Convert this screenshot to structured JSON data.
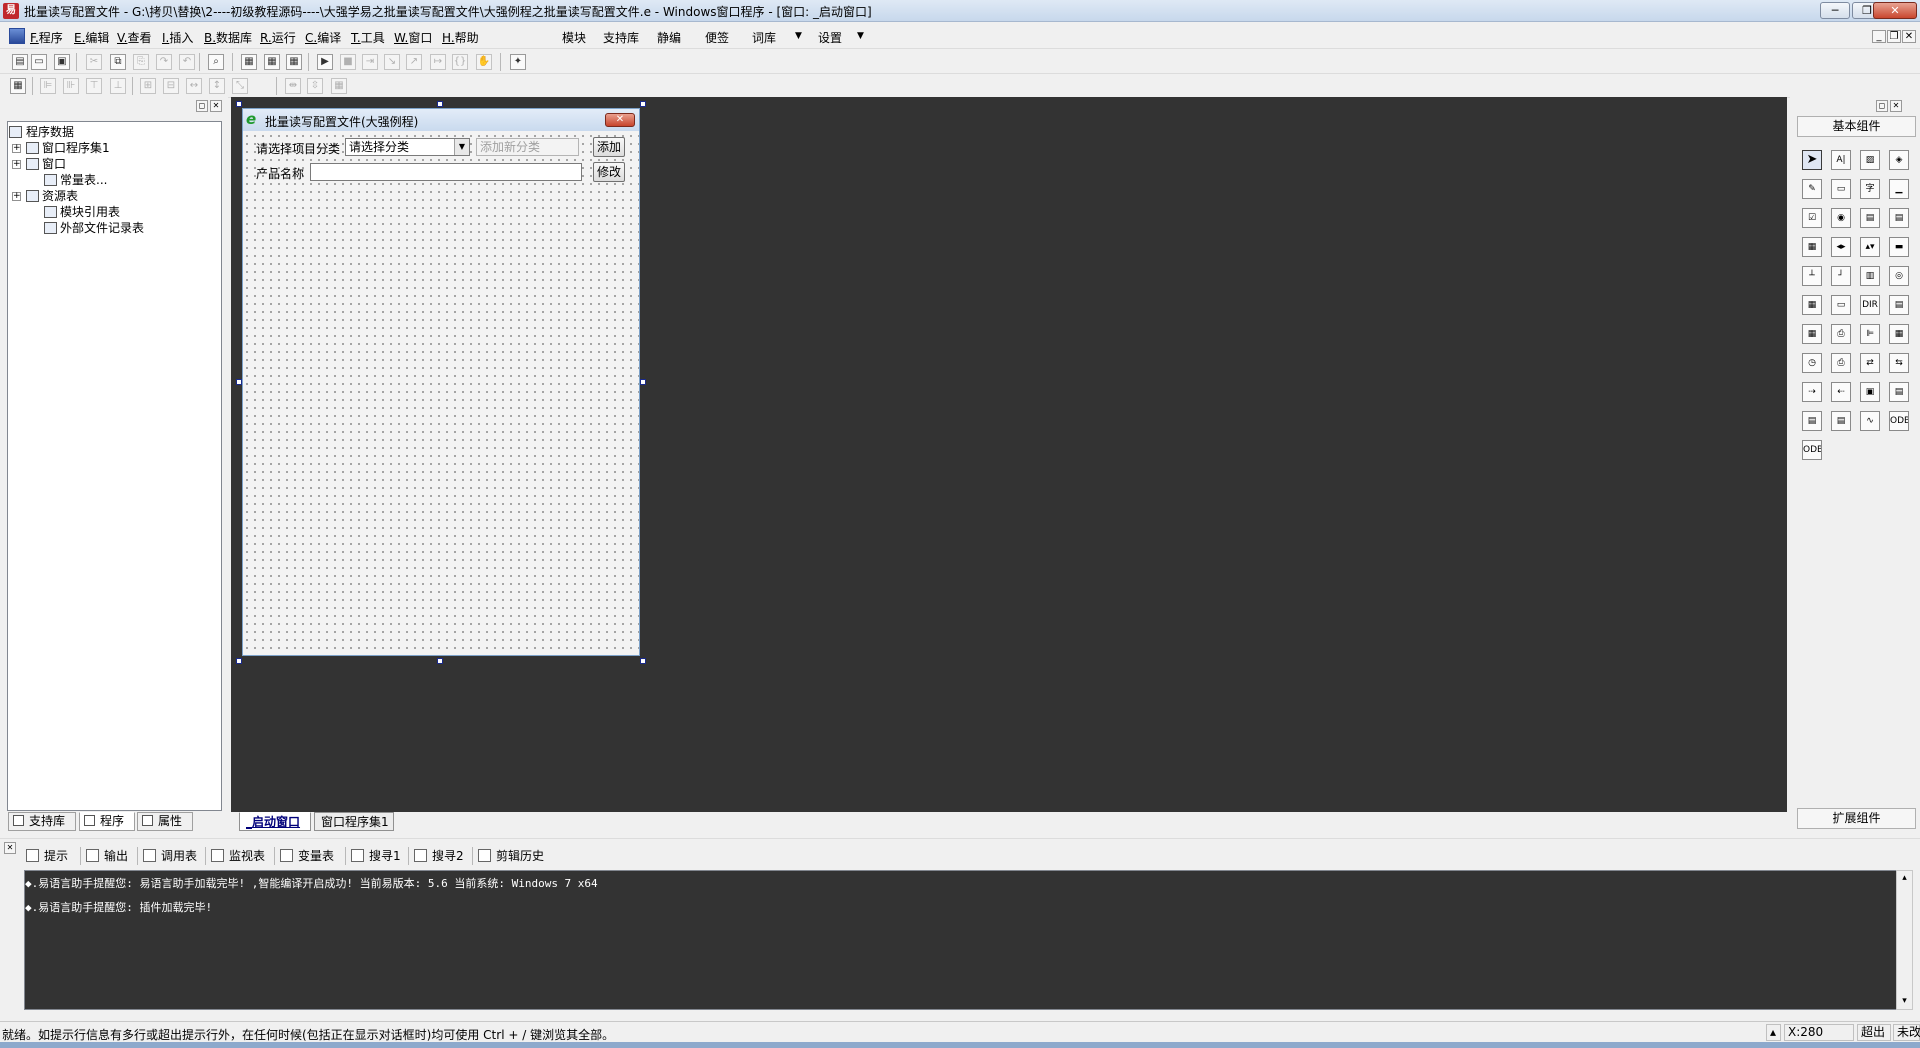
{
  "window": {
    "title": "批量读写配置文件 - G:\\拷贝\\替换\\2----初级教程源码----\\大强学易之批量读写配置文件\\大强例程之批量读写配置文件.e - Windows窗口程序 - [窗口: _启动窗口]",
    "min_glyph": "─",
    "restore_glyph": "❐",
    "close_glyph": "✕"
  },
  "menu": {
    "items": [
      {
        "key": "F.",
        "label": "程序"
      },
      {
        "key": "E.",
        "label": "编辑"
      },
      {
        "key": "V.",
        "label": "查看"
      },
      {
        "key": "I.",
        "label": "插入"
      },
      {
        "key": "B.",
        "label": "数据库"
      },
      {
        "key": "R.",
        "label": "运行"
      },
      {
        "key": "C.",
        "label": "编译"
      },
      {
        "key": "T.",
        "label": "工具"
      },
      {
        "key": "W.",
        "label": "窗口"
      },
      {
        "key": "H.",
        "label": "帮助"
      }
    ],
    "extra": [
      "模块",
      "支持库",
      "静编",
      "便签",
      "词库",
      "设置"
    ],
    "dropdown_glyph": "▼",
    "mdi_min": "_",
    "mdi_restore": "❐",
    "mdi_close": "✕"
  },
  "toolbar1": {
    "icons": [
      "new-file-icon",
      "open-file-icon",
      "save-icon",
      "cut-icon",
      "copy-icon",
      "paste-icon",
      "redo-icon",
      "undo-icon",
      "find-icon",
      "layout-1-icon",
      "layout-2-icon",
      "layout-3-icon",
      "run-icon",
      "stop-icon",
      "step-icon",
      "step-in-icon",
      "step-out-icon",
      "run-to-cursor-icon",
      "breakpoint-icon",
      "hand-icon",
      "plugin-icon"
    ],
    "glyphs": [
      "▤",
      "▭",
      "▣",
      "✂",
      "⧉",
      "⎘",
      "↷",
      "↶",
      "⌕",
      "▦",
      "▦",
      "▦",
      "▶",
      "■",
      "⇥",
      "↘",
      "↗",
      "↦",
      "{}",
      "✋",
      "✦"
    ]
  },
  "toolbar2": {
    "icons": [
      "form-icon",
      "align-left-icon",
      "align-right-icon",
      "align-top-icon",
      "align-bottom-icon",
      "center-h-icon",
      "center-v-icon",
      "same-width-icon",
      "same-height-icon",
      "same-size-icon",
      "space-h-icon",
      "space-v-icon",
      "grid-icon"
    ],
    "glyphs": [
      "▦",
      "⊫",
      "⊪",
      "⊤",
      "⊥",
      "⊞",
      "⊟",
      "↔",
      "↕",
      "⤡",
      "⇹",
      "⇳",
      "▦"
    ]
  },
  "left_panel": {
    "pin_glyph": "◻",
    "close_glyph": "✕",
    "tree": [
      {
        "label": "程序数据",
        "expander": ""
      },
      {
        "label": "窗口程序集1",
        "expander": "+"
      },
      {
        "label": "窗口",
        "expander": "+"
      },
      {
        "label": "常量表...",
        "expander": ""
      },
      {
        "label": "资源表",
        "expander": "+"
      },
      {
        "label": "模块引用表",
        "expander": ""
      },
      {
        "label": "外部文件记录表",
        "expander": ""
      }
    ],
    "tabs": [
      "支持库",
      "程序",
      "属性"
    ]
  },
  "designer": {
    "title": "批量读写配置文件(大强例程)",
    "e_icon": "e",
    "close_glyph": "✕",
    "label_category": "请选择项目分类",
    "combo_value": "请选择分类",
    "combo_arrow": "▼",
    "new_category_placeholder": "添加新分类",
    "add_button": "添加",
    "label_product": "产品名称",
    "product_value": "",
    "modify_button": "修改"
  },
  "workspace_tabs": [
    "_启动窗口",
    "窗口程序集1"
  ],
  "right_panel": {
    "header_basic": "基本组件",
    "header_ext": "扩展组件",
    "pin_glyph": "◻",
    "close_glyph": "✕",
    "components": [
      {
        "icon": "pointer-icon",
        "glyph": "➤"
      },
      {
        "icon": "label-icon",
        "glyph": "A|"
      },
      {
        "icon": "picture-box-icon",
        "glyph": "▨"
      },
      {
        "icon": "shape-icon",
        "glyph": "◈"
      },
      {
        "icon": "drawing-board-icon",
        "glyph": "✎"
      },
      {
        "icon": "tab-icon",
        "glyph": "▭"
      },
      {
        "icon": "text-label-icon",
        "glyph": "字"
      },
      {
        "icon": "edit-box-icon",
        "glyph": "▁"
      },
      {
        "icon": "checkbox-icon",
        "glyph": "☑"
      },
      {
        "icon": "radio-icon",
        "glyph": "◉"
      },
      {
        "icon": "combo-box-icon",
        "glyph": "▤"
      },
      {
        "icon": "list-box-icon",
        "glyph": "▤"
      },
      {
        "icon": "grid-list-icon",
        "glyph": "▦"
      },
      {
        "icon": "hscroll-icon",
        "glyph": "◂▸"
      },
      {
        "icon": "vscroll-icon",
        "glyph": "▴▾"
      },
      {
        "icon": "progress-icon",
        "glyph": "▬"
      },
      {
        "icon": "slider-icon",
        "glyph": "┴"
      },
      {
        "icon": "tab-control-icon",
        "glyph": "┘"
      },
      {
        "icon": "split-icon",
        "glyph": "▥"
      },
      {
        "icon": "image-list-icon",
        "glyph": "◎"
      },
      {
        "icon": "calendar-icon",
        "glyph": "▦"
      },
      {
        "icon": "button-icon",
        "glyph": "▭"
      },
      {
        "icon": "folder-icon",
        "glyph": "DIR"
      },
      {
        "icon": "file-box-icon",
        "glyph": "▤"
      },
      {
        "icon": "table-icon",
        "glyph": "▦"
      },
      {
        "icon": "printer-icon",
        "glyph": "⎙"
      },
      {
        "icon": "align-icon",
        "glyph": "⊫"
      },
      {
        "icon": "data-grid-icon",
        "glyph": "▦"
      },
      {
        "icon": "timer-icon",
        "glyph": "◷"
      },
      {
        "icon": "print-icon",
        "glyph": "⎙"
      },
      {
        "icon": "net-icon",
        "glyph": "⇄"
      },
      {
        "icon": "socket-icon",
        "glyph": "⇆"
      },
      {
        "icon": "client-icon",
        "glyph": "⇢"
      },
      {
        "icon": "server-icon",
        "glyph": "⇠"
      },
      {
        "icon": "frame-icon",
        "glyph": "▣"
      },
      {
        "icon": "panel-icon",
        "glyph": "▤"
      },
      {
        "icon": "db-table-icon",
        "glyph": "▤"
      },
      {
        "icon": "db-provider-icon",
        "glyph": "▤"
      },
      {
        "icon": "chart-icon",
        "glyph": "∿"
      },
      {
        "icon": "odbc-icon",
        "glyph": "ODBC"
      },
      {
        "icon": "odbc-source-icon",
        "glyph": "ODBC"
      }
    ]
  },
  "output": {
    "tabs": [
      "提示",
      "输出",
      "调用表",
      "监视表",
      "变量表",
      "搜寻1",
      "搜寻2",
      "剪辑历史"
    ],
    "lines": [
      "◆.易语言助手提醒您: 易语言助手加载完毕!  ,智能编译开启成功!  当前易版本: 5.6  当前系统: Windows 7 x64",
      "◆.易语言助手提醒您: 插件加载完毕!"
    ],
    "pin_glyph": "◻",
    "close_glyph": "✕",
    "scroll_up": "▴",
    "scroll_down": "▾"
  },
  "status": {
    "message": "就绪。如提示行信息有多行或超出提示行外，在任何时候(包括正在显示对话框时)均可使用 Ctrl + / 键浏览其全部。",
    "coord": "X:280",
    "ovr": "超出",
    "state": "未改"
  },
  "colors": {
    "workspace_bg": "#333333",
    "title_gradient_top": "#dfe9f5",
    "close_red": "#c9472f"
  }
}
